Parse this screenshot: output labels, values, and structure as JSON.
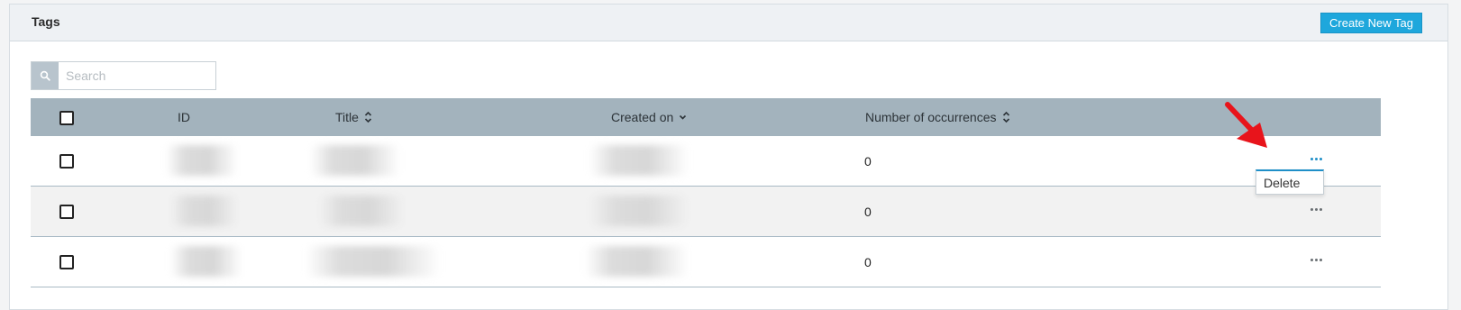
{
  "header": {
    "title": "Tags",
    "create_button": "Create New Tag"
  },
  "search": {
    "placeholder": "Search"
  },
  "table": {
    "columns": {
      "id": "ID",
      "title": "Title",
      "created_on": "Created on",
      "occurrences": "Number of occurrences"
    },
    "rows": [
      {
        "occurrences": "0"
      },
      {
        "occurrences": "0"
      },
      {
        "occurrences": "0"
      }
    ]
  },
  "row_menu": {
    "delete": "Delete"
  },
  "colors": {
    "accent": "#1ea7dc",
    "table_header": "#a3b3bd",
    "annotation": "#e8141b"
  }
}
